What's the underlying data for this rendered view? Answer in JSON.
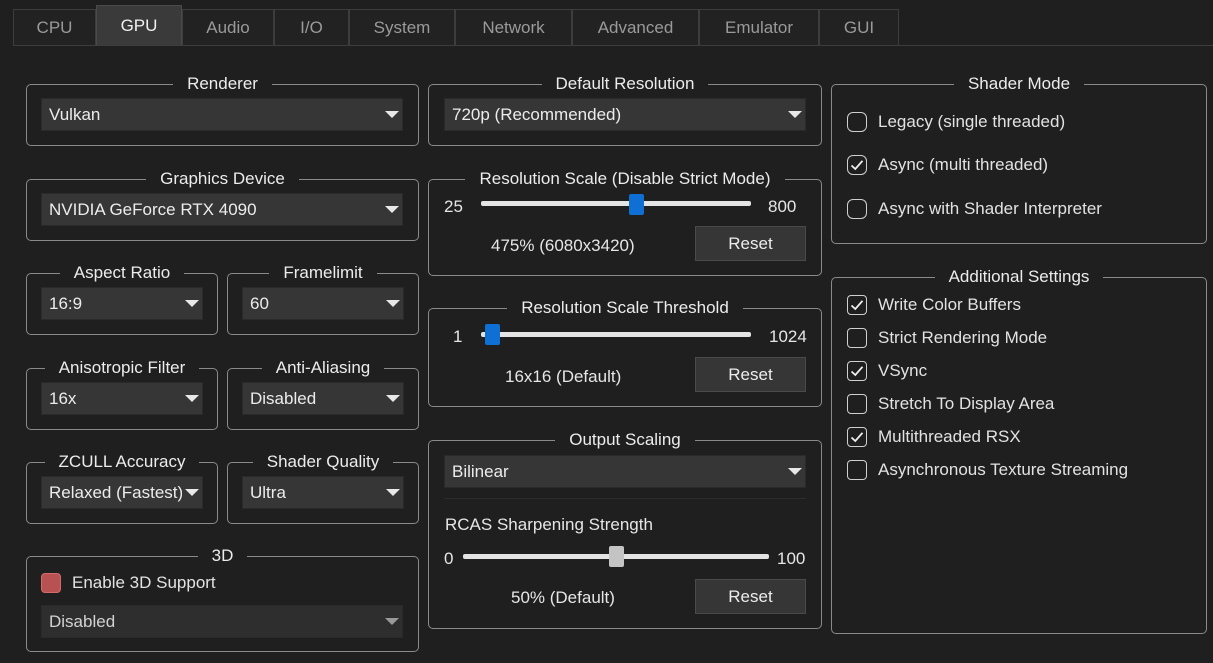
{
  "tabs": [
    "CPU",
    "GPU",
    "Audio",
    "I/O",
    "System",
    "Network",
    "Advanced",
    "Emulator",
    "GUI"
  ],
  "active_tab": "GPU",
  "renderer": {
    "title": "Renderer",
    "value": "Vulkan"
  },
  "graphics_device": {
    "title": "Graphics Device",
    "value": "NVIDIA GeForce RTX 4090"
  },
  "aspect_ratio": {
    "title": "Aspect Ratio",
    "value": "16:9"
  },
  "framelimit": {
    "title": "Framelimit",
    "value": "60"
  },
  "anisotropic_filter": {
    "title": "Anisotropic Filter",
    "value": "16x"
  },
  "anti_aliasing": {
    "title": "Anti-Aliasing",
    "value": "Disabled"
  },
  "zcull_accuracy": {
    "title": "ZCULL Accuracy",
    "value": "Relaxed (Fastest)"
  },
  "shader_quality": {
    "title": "Shader Quality",
    "value": "Ultra"
  },
  "three_d": {
    "title": "3D",
    "checkbox_label": "Enable 3D Support",
    "mode_value": "Disabled"
  },
  "default_resolution": {
    "title": "Default Resolution",
    "value": "720p (Recommended)"
  },
  "resolution_scale": {
    "title": "Resolution Scale (Disable Strict Mode)",
    "min": "25",
    "max": "800",
    "value": 475,
    "value_label": "475% (6080x3420)",
    "reset_label": "Reset"
  },
  "resolution_scale_threshold": {
    "title": "Resolution Scale Threshold",
    "min": "1",
    "max": "1024",
    "value": 16,
    "value_label": "16x16 (Default)",
    "reset_label": "Reset"
  },
  "output_scaling": {
    "title": "Output Scaling",
    "value": "Bilinear",
    "rcas_label": "RCAS Sharpening Strength",
    "min": "0",
    "max": "100",
    "value_num": 50,
    "value_label": "50% (Default)",
    "reset_label": "Reset"
  },
  "shader_mode": {
    "title": "Shader Mode",
    "options": [
      {
        "label": "Legacy (single threaded)",
        "checked": false
      },
      {
        "label": "Async (multi threaded)",
        "checked": true
      },
      {
        "label": "Async with Shader Interpreter",
        "checked": false
      }
    ]
  },
  "additional_settings": {
    "title": "Additional Settings",
    "options": [
      {
        "label": "Write Color Buffers",
        "checked": true
      },
      {
        "label": "Strict Rendering Mode",
        "checked": false
      },
      {
        "label": "VSync",
        "checked": true
      },
      {
        "label": "Stretch To Display Area",
        "checked": false
      },
      {
        "label": "Multithreaded RSX",
        "checked": true
      },
      {
        "label": "Asynchronous Texture Streaming",
        "checked": false
      }
    ]
  },
  "colors": {
    "accent": "#0e6fd4",
    "enable3d_box": "#b85252"
  }
}
